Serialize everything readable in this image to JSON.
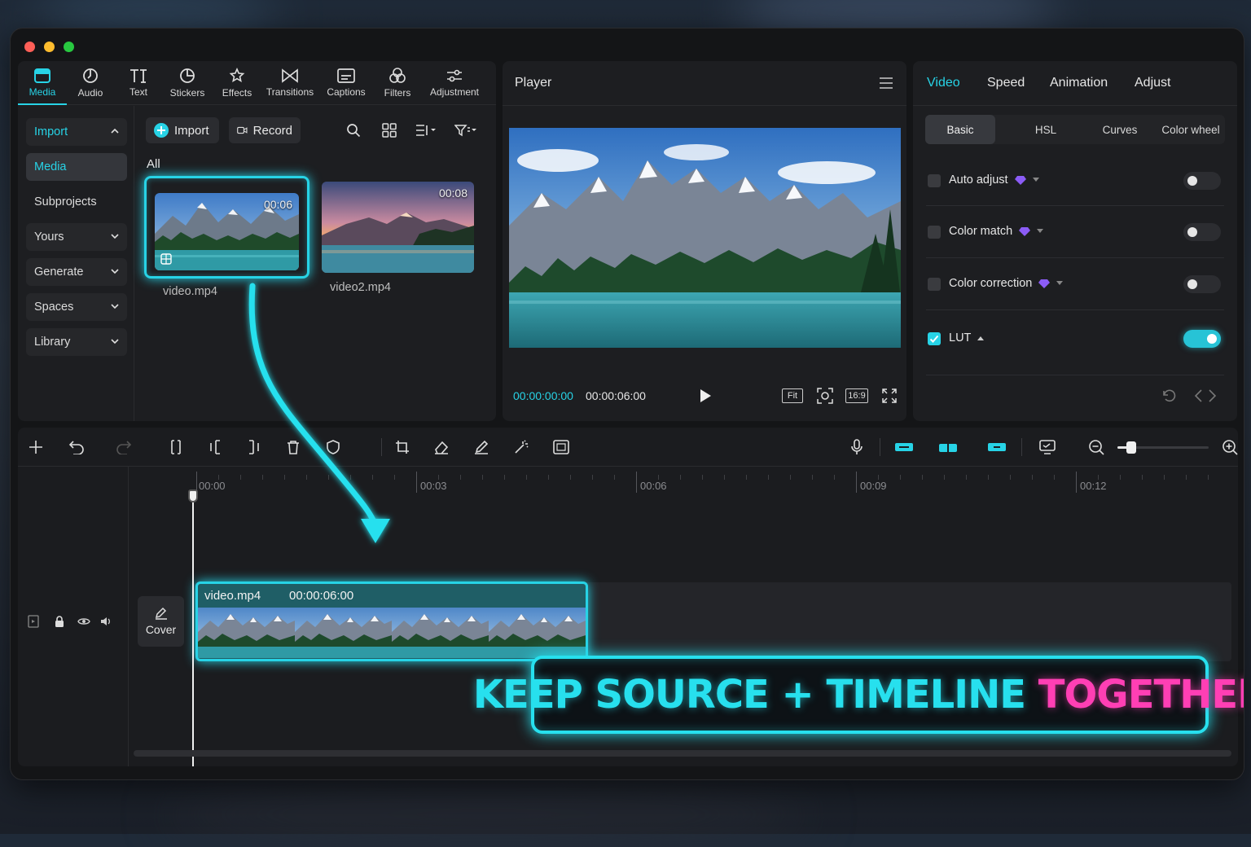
{
  "colors": {
    "accent": "#27d3e6",
    "banner_cyan": "#27e0ee",
    "banner_pink": "#ff3fb4",
    "window": "#141517",
    "panel": "#1d1e21"
  },
  "toolbar": {
    "tabs": [
      {
        "label": "Media",
        "icon": "media-icon"
      },
      {
        "label": "Audio",
        "icon": "audio-icon"
      },
      {
        "label": "Text",
        "icon": "text-icon"
      },
      {
        "label": "Stickers",
        "icon": "stickers-icon"
      },
      {
        "label": "Effects",
        "icon": "effects-icon"
      },
      {
        "label": "Transitions",
        "icon": "transitions-icon"
      },
      {
        "label": "Captions",
        "icon": "captions-icon"
      },
      {
        "label": "Filters",
        "icon": "filters-icon"
      },
      {
        "label": "Adjustment",
        "icon": "adjustment-icon"
      }
    ]
  },
  "sidebar": {
    "items": [
      {
        "label": "Import"
      },
      {
        "label": "Media"
      },
      {
        "label": "Subprojects"
      },
      {
        "label": "Yours"
      },
      {
        "label": "Generate"
      },
      {
        "label": "Spaces"
      },
      {
        "label": "Library"
      }
    ]
  },
  "media": {
    "import_label": "Import",
    "record_label": "Record",
    "filter_label": "All",
    "files": [
      {
        "name": "video.mp4",
        "duration": "00:06"
      },
      {
        "name": "video2.mp4",
        "duration": "00:08"
      }
    ]
  },
  "player": {
    "title": "Player",
    "current_time": "00:00:00:00",
    "total_time": "00:00:06:00",
    "fit_label": "Fit",
    "ratio_label": "16:9"
  },
  "inspector": {
    "tabs": [
      "Video",
      "Speed",
      "Animation",
      "Adjust"
    ],
    "subtabs": [
      "Basic",
      "HSL",
      "Curves",
      "Color wheel"
    ],
    "rows": [
      {
        "label": "Auto adjust",
        "checked": false,
        "on": false
      },
      {
        "label": "Color match",
        "checked": false,
        "on": false
      },
      {
        "label": "Color correction",
        "checked": false,
        "on": false
      },
      {
        "label": "LUT",
        "checked": true,
        "on": true
      }
    ]
  },
  "timeline": {
    "ticks": [
      "00:00",
      "00:03",
      "00:06",
      "00:09",
      "00:12"
    ],
    "cover_label": "Cover",
    "clip": {
      "name": "video.mp4",
      "duration": "00:00:06:00"
    },
    "zoom_level": 0.15
  },
  "banner": {
    "part1": "KEEP SOURCE + TIMELINE ",
    "part2": "TOGETHER"
  }
}
